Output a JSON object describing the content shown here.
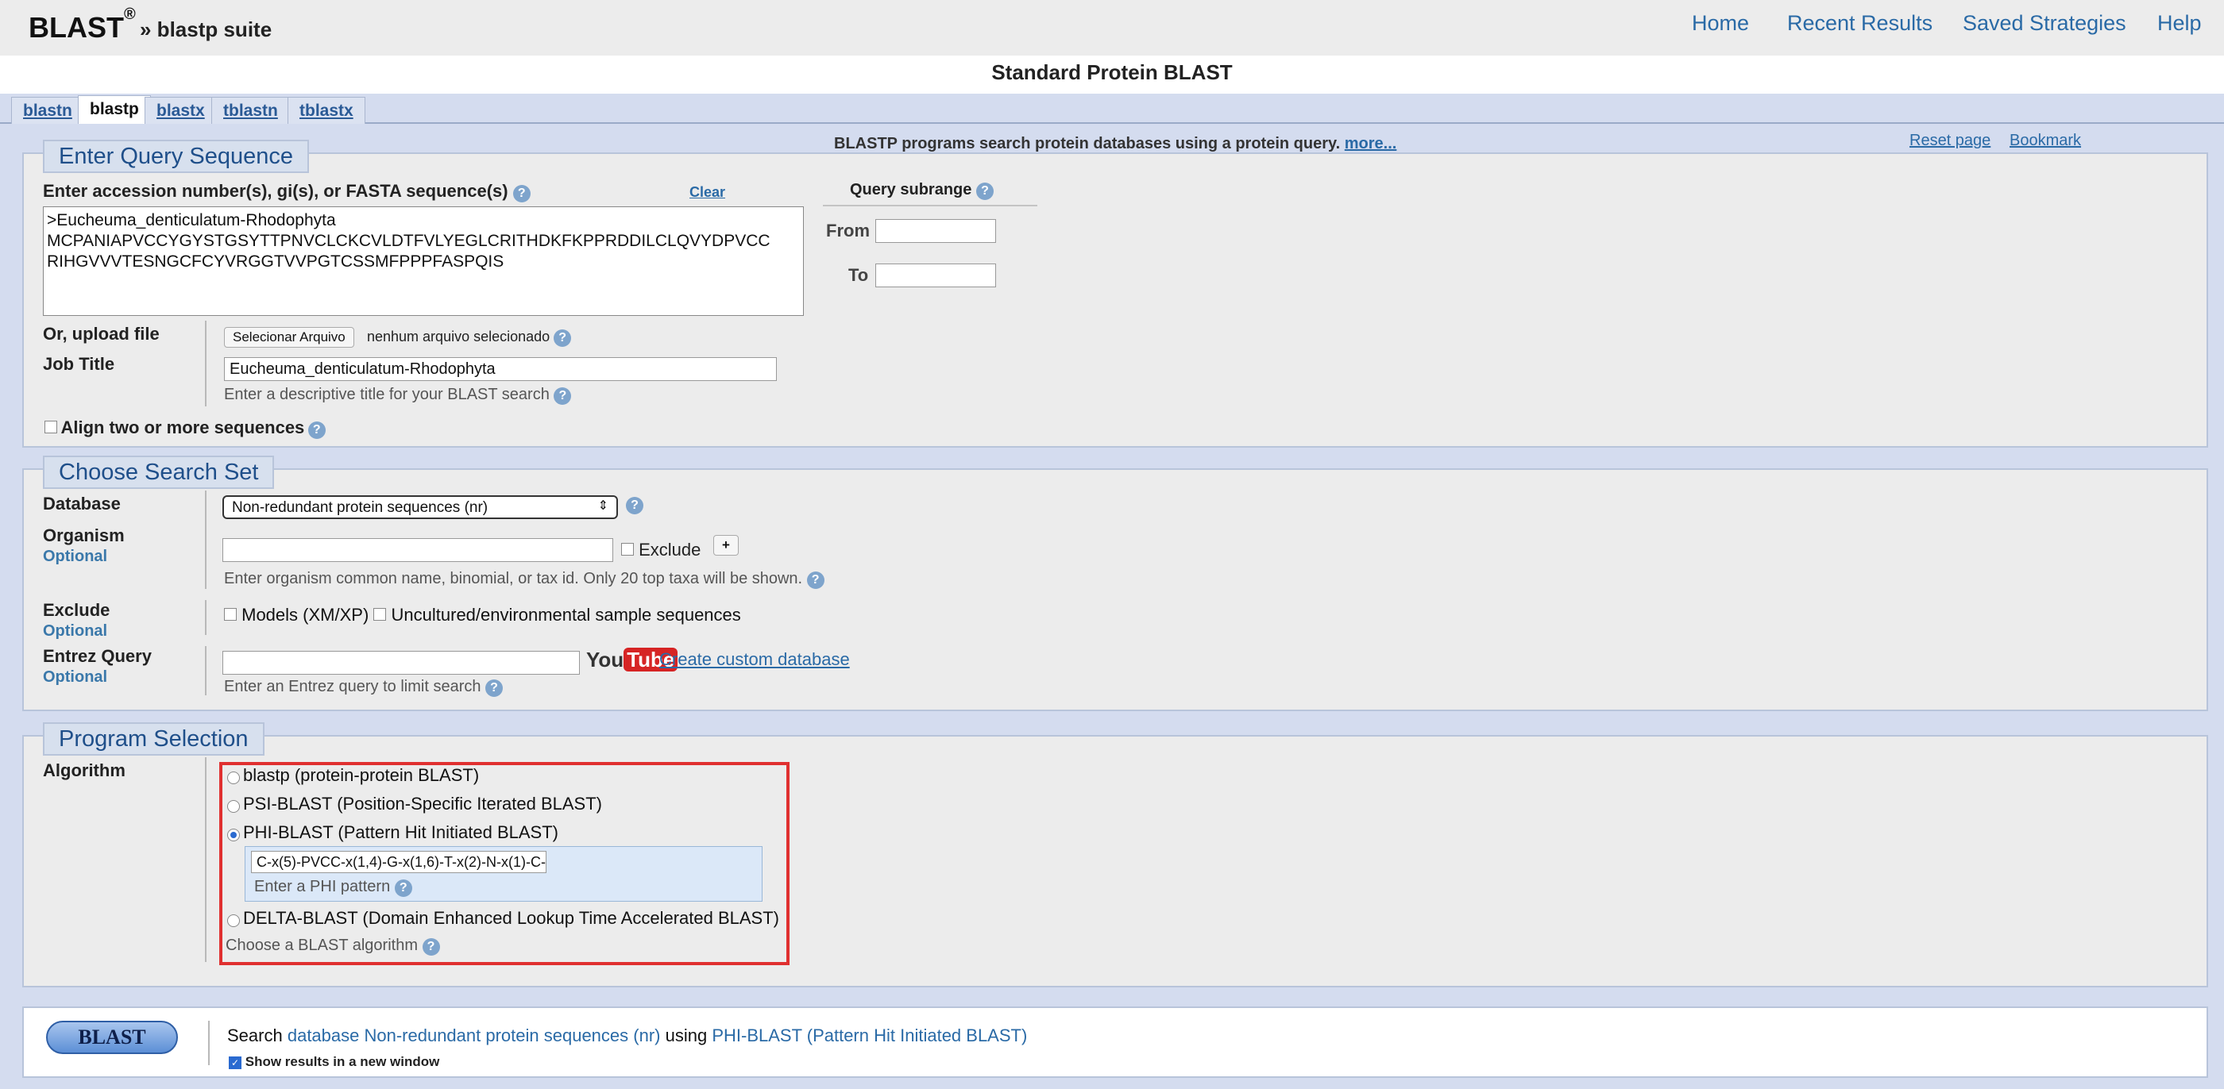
{
  "header": {
    "logo": "BLAST",
    "logo_mark": "®",
    "suite": "» blastp suite",
    "nav": [
      "Home",
      "Recent Results",
      "Saved Strategies",
      "Help"
    ]
  },
  "page_title": "Standard Protein BLAST",
  "tabs": [
    "blastn",
    "blastp",
    "blastx",
    "tblastn",
    "tblastx"
  ],
  "active_tab": "blastp",
  "info_bar": {
    "text": "BLASTP programs search protein databases using a protein query.",
    "more": "more...",
    "reset": "Reset page",
    "bookmark": "Bookmark"
  },
  "query": {
    "legend": "Enter Query Sequence",
    "label": "Enter accession number(s), gi(s), or FASTA sequence(s)",
    "clear": "Clear",
    "sequence_lines": [
      ">Eucheuma_denticulatum-Rhodophyta",
      "MCPANIAPVCCYGYSTGSYTTPNVCLCKCVLDTFVLYEGLCRITHDKFKPPRDDILCLQVYDPVCC",
      "RIHGVVVTESNGCFCYVRGGTVVPGTCSSMFPPPFASPQIS"
    ],
    "subrange_title": "Query subrange",
    "from_label": "From",
    "to_label": "To",
    "upload_label": "Or, upload file",
    "upload_button": "Selecionar Arquivo",
    "upload_status": "nenhum arquivo selecionado",
    "job_title_label": "Job Title",
    "job_title_value": "Eucheuma_denticulatum-Rhodophyta",
    "job_title_hint": "Enter a descriptive title for your BLAST search",
    "align_label": "Align two or more sequences"
  },
  "search_set": {
    "legend": "Choose Search Set",
    "database_label": "Database",
    "database_value": "Non-redundant protein sequences (nr)",
    "organism_label": "Organism",
    "optional": "Optional",
    "exclude_check": "Exclude",
    "plus": "+",
    "organism_hint": "Enter organism common name, binomial, or tax id. Only 20 top taxa will be shown.",
    "exclude_label": "Exclude",
    "exclude_models": "Models (XM/XP)",
    "exclude_uncultured": "Uncultured/environmental sample sequences",
    "entrez_label": "Entrez Query",
    "youtube_you": "You",
    "youtube_tube": "Tube",
    "custom_db": "Create custom database",
    "entrez_hint": "Enter an Entrez query to limit search"
  },
  "program": {
    "legend": "Program Selection",
    "algorithm_label": "Algorithm",
    "options": [
      "blastp (protein-protein BLAST)",
      "PSI-BLAST (Position-Specific Iterated BLAST)",
      "PHI-BLAST (Pattern Hit Initiated BLAST)",
      "DELTA-BLAST (Domain Enhanced Lookup Time Accelerated BLAST)"
    ],
    "selected": "PHI-BLAST (Pattern Hit Initiated BLAST)",
    "phi_pattern_value": "C-x(5)-PVCC-x(1,4)-G-x(1,6)-T-x(2)-N-x(1)-C-",
    "phi_hint": "Enter a PHI pattern",
    "choose_hint": "Choose a BLAST algorithm"
  },
  "submit": {
    "button": "BLAST",
    "search_word": "Search",
    "db_phrase": "database Non-redundant protein sequences (nr)",
    "using_word": "using",
    "algo_phrase": "PHI-BLAST (Pattern Hit Initiated BLAST)",
    "new_window": "Show results in a new window"
  },
  "colors": {
    "accent_blue": "#2a6aa6",
    "highlight_red": "#e03030",
    "panel_bg": "#ececec",
    "page_bg": "#d4dcef"
  }
}
